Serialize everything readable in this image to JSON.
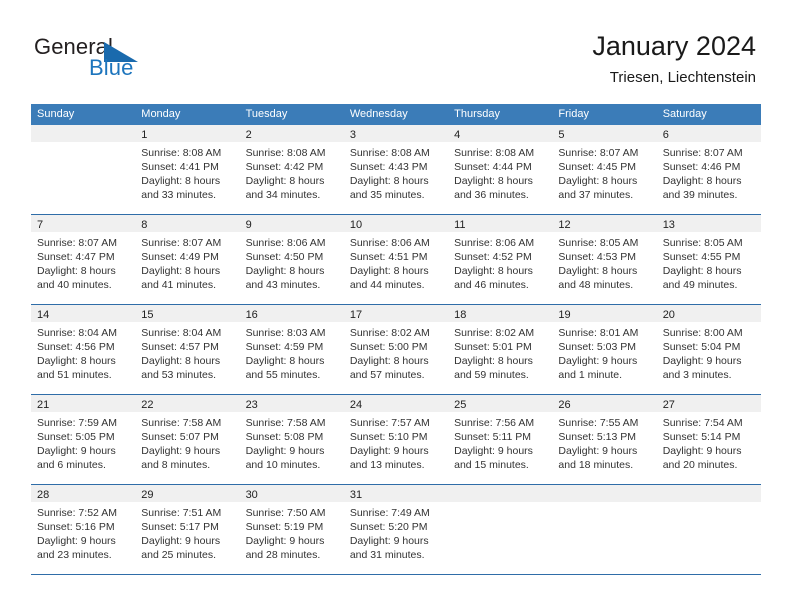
{
  "brand": {
    "name_part1": "General",
    "name_part2": "Blue",
    "triangle_icon": "blue-triangle-logo-mark",
    "color_dark": "#231f20",
    "color_blue": "#1d75bd"
  },
  "header": {
    "title": "January 2024",
    "subtitle": "Triesen, Liechtenstein"
  },
  "colors": {
    "header_band": "#3b7cb8",
    "row_divider": "#2f6da8",
    "day_number_band": "#f0f0f0",
    "text": "#333333"
  },
  "weekdays": [
    "Sunday",
    "Monday",
    "Tuesday",
    "Wednesday",
    "Thursday",
    "Friday",
    "Saturday"
  ],
  "weeks": [
    [
      {
        "day": "",
        "empty": true,
        "sunrise": "",
        "sunset": "",
        "daylight_1": "",
        "daylight_2": ""
      },
      {
        "day": "1",
        "sunrise": "Sunrise: 8:08 AM",
        "sunset": "Sunset: 4:41 PM",
        "daylight_1": "Daylight: 8 hours",
        "daylight_2": "and 33 minutes."
      },
      {
        "day": "2",
        "sunrise": "Sunrise: 8:08 AM",
        "sunset": "Sunset: 4:42 PM",
        "daylight_1": "Daylight: 8 hours",
        "daylight_2": "and 34 minutes."
      },
      {
        "day": "3",
        "sunrise": "Sunrise: 8:08 AM",
        "sunset": "Sunset: 4:43 PM",
        "daylight_1": "Daylight: 8 hours",
        "daylight_2": "and 35 minutes."
      },
      {
        "day": "4",
        "sunrise": "Sunrise: 8:08 AM",
        "sunset": "Sunset: 4:44 PM",
        "daylight_1": "Daylight: 8 hours",
        "daylight_2": "and 36 minutes."
      },
      {
        "day": "5",
        "sunrise": "Sunrise: 8:07 AM",
        "sunset": "Sunset: 4:45 PM",
        "daylight_1": "Daylight: 8 hours",
        "daylight_2": "and 37 minutes."
      },
      {
        "day": "6",
        "sunrise": "Sunrise: 8:07 AM",
        "sunset": "Sunset: 4:46 PM",
        "daylight_1": "Daylight: 8 hours",
        "daylight_2": "and 39 minutes."
      }
    ],
    [
      {
        "day": "7",
        "sunrise": "Sunrise: 8:07 AM",
        "sunset": "Sunset: 4:47 PM",
        "daylight_1": "Daylight: 8 hours",
        "daylight_2": "and 40 minutes."
      },
      {
        "day": "8",
        "sunrise": "Sunrise: 8:07 AM",
        "sunset": "Sunset: 4:49 PM",
        "daylight_1": "Daylight: 8 hours",
        "daylight_2": "and 41 minutes."
      },
      {
        "day": "9",
        "sunrise": "Sunrise: 8:06 AM",
        "sunset": "Sunset: 4:50 PM",
        "daylight_1": "Daylight: 8 hours",
        "daylight_2": "and 43 minutes."
      },
      {
        "day": "10",
        "sunrise": "Sunrise: 8:06 AM",
        "sunset": "Sunset: 4:51 PM",
        "daylight_1": "Daylight: 8 hours",
        "daylight_2": "and 44 minutes."
      },
      {
        "day": "11",
        "sunrise": "Sunrise: 8:06 AM",
        "sunset": "Sunset: 4:52 PM",
        "daylight_1": "Daylight: 8 hours",
        "daylight_2": "and 46 minutes."
      },
      {
        "day": "12",
        "sunrise": "Sunrise: 8:05 AM",
        "sunset": "Sunset: 4:53 PM",
        "daylight_1": "Daylight: 8 hours",
        "daylight_2": "and 48 minutes."
      },
      {
        "day": "13",
        "sunrise": "Sunrise: 8:05 AM",
        "sunset": "Sunset: 4:55 PM",
        "daylight_1": "Daylight: 8 hours",
        "daylight_2": "and 49 minutes."
      }
    ],
    [
      {
        "day": "14",
        "sunrise": "Sunrise: 8:04 AM",
        "sunset": "Sunset: 4:56 PM",
        "daylight_1": "Daylight: 8 hours",
        "daylight_2": "and 51 minutes."
      },
      {
        "day": "15",
        "sunrise": "Sunrise: 8:04 AM",
        "sunset": "Sunset: 4:57 PM",
        "daylight_1": "Daylight: 8 hours",
        "daylight_2": "and 53 minutes."
      },
      {
        "day": "16",
        "sunrise": "Sunrise: 8:03 AM",
        "sunset": "Sunset: 4:59 PM",
        "daylight_1": "Daylight: 8 hours",
        "daylight_2": "and 55 minutes."
      },
      {
        "day": "17",
        "sunrise": "Sunrise: 8:02 AM",
        "sunset": "Sunset: 5:00 PM",
        "daylight_1": "Daylight: 8 hours",
        "daylight_2": "and 57 minutes."
      },
      {
        "day": "18",
        "sunrise": "Sunrise: 8:02 AM",
        "sunset": "Sunset: 5:01 PM",
        "daylight_1": "Daylight: 8 hours",
        "daylight_2": "and 59 minutes."
      },
      {
        "day": "19",
        "sunrise": "Sunrise: 8:01 AM",
        "sunset": "Sunset: 5:03 PM",
        "daylight_1": "Daylight: 9 hours",
        "daylight_2": "and 1 minute."
      },
      {
        "day": "20",
        "sunrise": "Sunrise: 8:00 AM",
        "sunset": "Sunset: 5:04 PM",
        "daylight_1": "Daylight: 9 hours",
        "daylight_2": "and 3 minutes."
      }
    ],
    [
      {
        "day": "21",
        "sunrise": "Sunrise: 7:59 AM",
        "sunset": "Sunset: 5:05 PM",
        "daylight_1": "Daylight: 9 hours",
        "daylight_2": "and 6 minutes."
      },
      {
        "day": "22",
        "sunrise": "Sunrise: 7:58 AM",
        "sunset": "Sunset: 5:07 PM",
        "daylight_1": "Daylight: 9 hours",
        "daylight_2": "and 8 minutes."
      },
      {
        "day": "23",
        "sunrise": "Sunrise: 7:58 AM",
        "sunset": "Sunset: 5:08 PM",
        "daylight_1": "Daylight: 9 hours",
        "daylight_2": "and 10 minutes."
      },
      {
        "day": "24",
        "sunrise": "Sunrise: 7:57 AM",
        "sunset": "Sunset: 5:10 PM",
        "daylight_1": "Daylight: 9 hours",
        "daylight_2": "and 13 minutes."
      },
      {
        "day": "25",
        "sunrise": "Sunrise: 7:56 AM",
        "sunset": "Sunset: 5:11 PM",
        "daylight_1": "Daylight: 9 hours",
        "daylight_2": "and 15 minutes."
      },
      {
        "day": "26",
        "sunrise": "Sunrise: 7:55 AM",
        "sunset": "Sunset: 5:13 PM",
        "daylight_1": "Daylight: 9 hours",
        "daylight_2": "and 18 minutes."
      },
      {
        "day": "27",
        "sunrise": "Sunrise: 7:54 AM",
        "sunset": "Sunset: 5:14 PM",
        "daylight_1": "Daylight: 9 hours",
        "daylight_2": "and 20 minutes."
      }
    ],
    [
      {
        "day": "28",
        "sunrise": "Sunrise: 7:52 AM",
        "sunset": "Sunset: 5:16 PM",
        "daylight_1": "Daylight: 9 hours",
        "daylight_2": "and 23 minutes."
      },
      {
        "day": "29",
        "sunrise": "Sunrise: 7:51 AM",
        "sunset": "Sunset: 5:17 PM",
        "daylight_1": "Daylight: 9 hours",
        "daylight_2": "and 25 minutes."
      },
      {
        "day": "30",
        "sunrise": "Sunrise: 7:50 AM",
        "sunset": "Sunset: 5:19 PM",
        "daylight_1": "Daylight: 9 hours",
        "daylight_2": "and 28 minutes."
      },
      {
        "day": "31",
        "sunrise": "Sunrise: 7:49 AM",
        "sunset": "Sunset: 5:20 PM",
        "daylight_1": "Daylight: 9 hours",
        "daylight_2": "and 31 minutes."
      },
      {
        "day": "",
        "empty": true,
        "sunrise": "",
        "sunset": "",
        "daylight_1": "",
        "daylight_2": ""
      },
      {
        "day": "",
        "empty": true,
        "sunrise": "",
        "sunset": "",
        "daylight_1": "",
        "daylight_2": ""
      },
      {
        "day": "",
        "empty": true,
        "sunrise": "",
        "sunset": "",
        "daylight_1": "",
        "daylight_2": ""
      }
    ]
  ]
}
